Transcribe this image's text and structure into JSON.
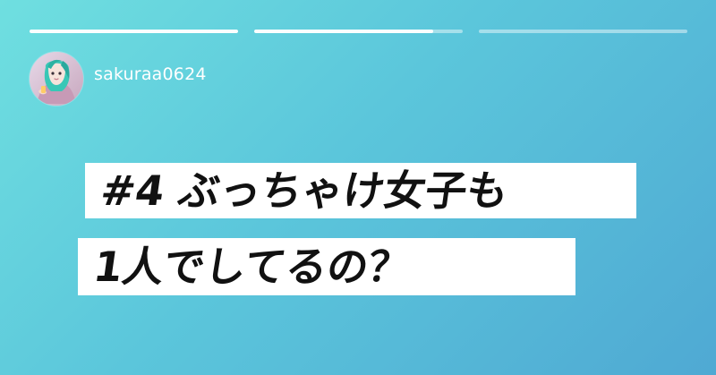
{
  "story": {
    "progress": [
      1,
      0.86,
      0
    ],
    "username": "sakuraa0624",
    "title_lines": [
      "#4 ぶっちゃけ女子も",
      "1人でしてるの？"
    ]
  },
  "colors": {
    "background_start": "#6fdfe0",
    "background_end": "#4fa9d3",
    "title_bg": "#ffffff",
    "title_text": "#111111"
  },
  "icons": {
    "avatar": "profile-avatar-illustration"
  }
}
